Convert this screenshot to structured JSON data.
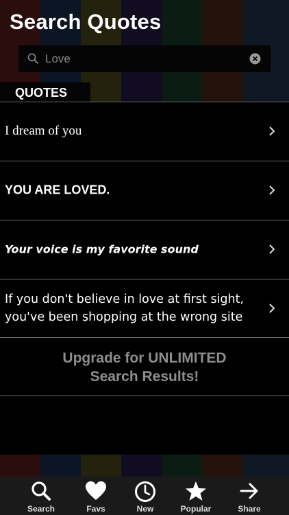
{
  "header": {
    "title": "Search Quotes"
  },
  "search": {
    "value": "Love"
  },
  "section": {
    "label": "QUOTES"
  },
  "quotes": [
    {
      "text": "I dream of you"
    },
    {
      "text": "YOU ARE LOVED."
    },
    {
      "text": "Your voice is my favorite sound"
    },
    {
      "text": "If you don't believe in love at first sight, you've been shopping at the wrong site"
    }
  ],
  "upgrade": {
    "line1": "Upgrade for UNLIMITED",
    "line2": "Search Results!"
  },
  "tabbar": {
    "items": [
      {
        "label": "Search",
        "icon": "search-icon"
      },
      {
        "label": "Favs",
        "icon": "heart-icon"
      },
      {
        "label": "New",
        "icon": "clock-icon"
      },
      {
        "label": "Popular",
        "icon": "star-icon"
      },
      {
        "label": "Share",
        "icon": "arrow-right-icon"
      }
    ]
  },
  "colors": {
    "background": "#000000",
    "tabbar": "#1a1a1a",
    "muted": "#8e8e8e",
    "divider": "#6a6a6a"
  }
}
